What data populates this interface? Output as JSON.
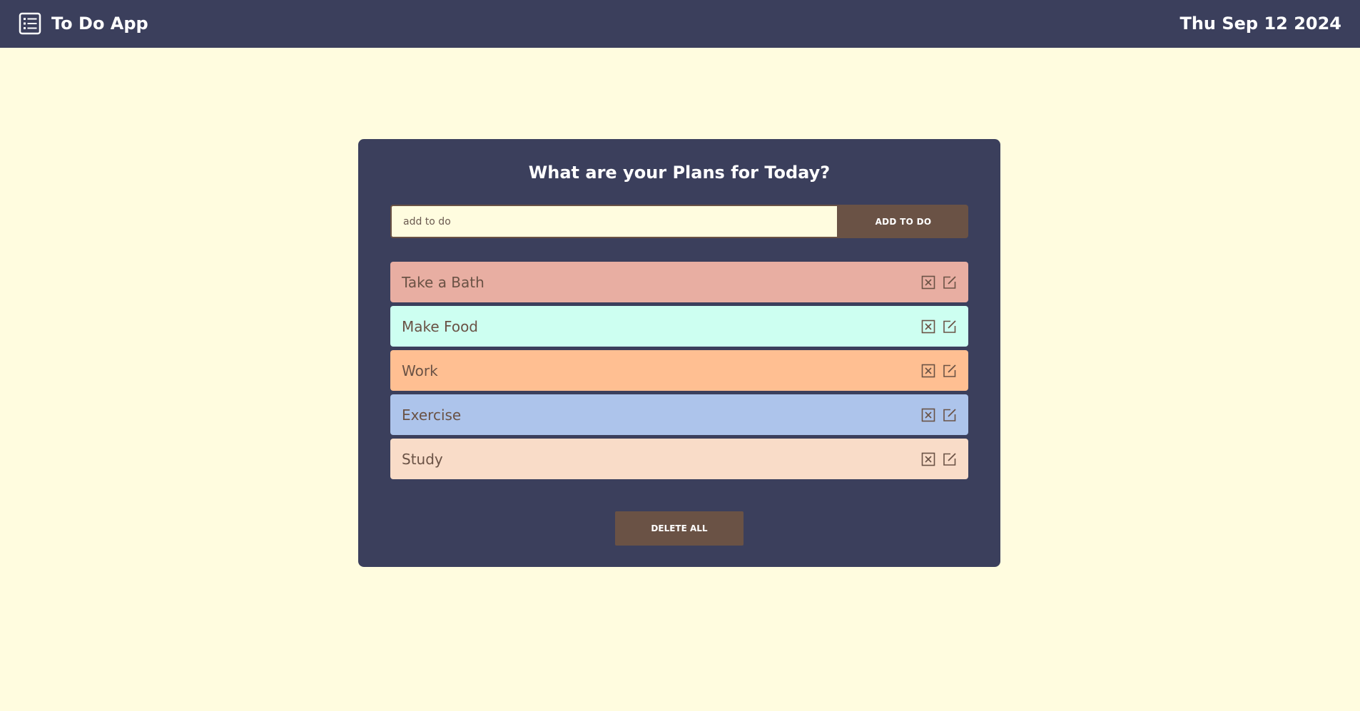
{
  "navbar": {
    "title": "To Do App",
    "icon": "list-icon",
    "date": "Thu Sep 12 2024"
  },
  "card": {
    "heading": "What are your Plans for Today?",
    "input": {
      "placeholder": "add to do",
      "value": ""
    },
    "add_button_label": "ADD TO DO",
    "delete_all_label": "DELETE ALL"
  },
  "todos": [
    {
      "label": "Take a Bath",
      "color": "#e8aea2"
    },
    {
      "label": "Make Food",
      "color": "#cdfff1"
    },
    {
      "label": "Work",
      "color": "#ffbf92"
    },
    {
      "label": "Exercise",
      "color": "#adc4eb"
    },
    {
      "label": "Study",
      "color": "#f9dcc8"
    }
  ],
  "colors": {
    "background": "#fffcdf",
    "navbar": "#3b3f5c",
    "card": "#3b3f5c",
    "button": "#6a5245",
    "todo_text": "#6a5245"
  },
  "icons": {
    "delete": "delete-x-icon",
    "edit": "edit-icon"
  }
}
